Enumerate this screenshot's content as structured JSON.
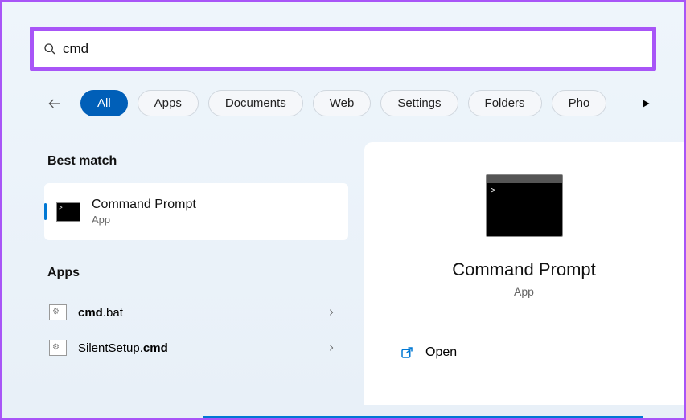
{
  "search": {
    "value": "cmd",
    "placeholder": ""
  },
  "filters": {
    "all": "All",
    "apps": "Apps",
    "documents": "Documents",
    "web": "Web",
    "settings": "Settings",
    "folders": "Folders",
    "photos": "Pho"
  },
  "left": {
    "best_match_header": "Best match",
    "best_match": {
      "title": "Command Prompt",
      "subtitle": "App"
    },
    "apps_header": "Apps",
    "apps": [
      {
        "bold": "cmd",
        "rest": ".bat"
      },
      {
        "bold": "",
        "rest_pre": "SilentSetup.",
        "bold2": "cmd",
        "rest": ""
      }
    ],
    "app1_label_bold": "cmd",
    "app1_label_rest": ".bat",
    "app2_label_pre": "SilentSetup.",
    "app2_label_bold": "cmd"
  },
  "right": {
    "title": "Command Prompt",
    "subtitle": "App",
    "open_label": "Open"
  }
}
